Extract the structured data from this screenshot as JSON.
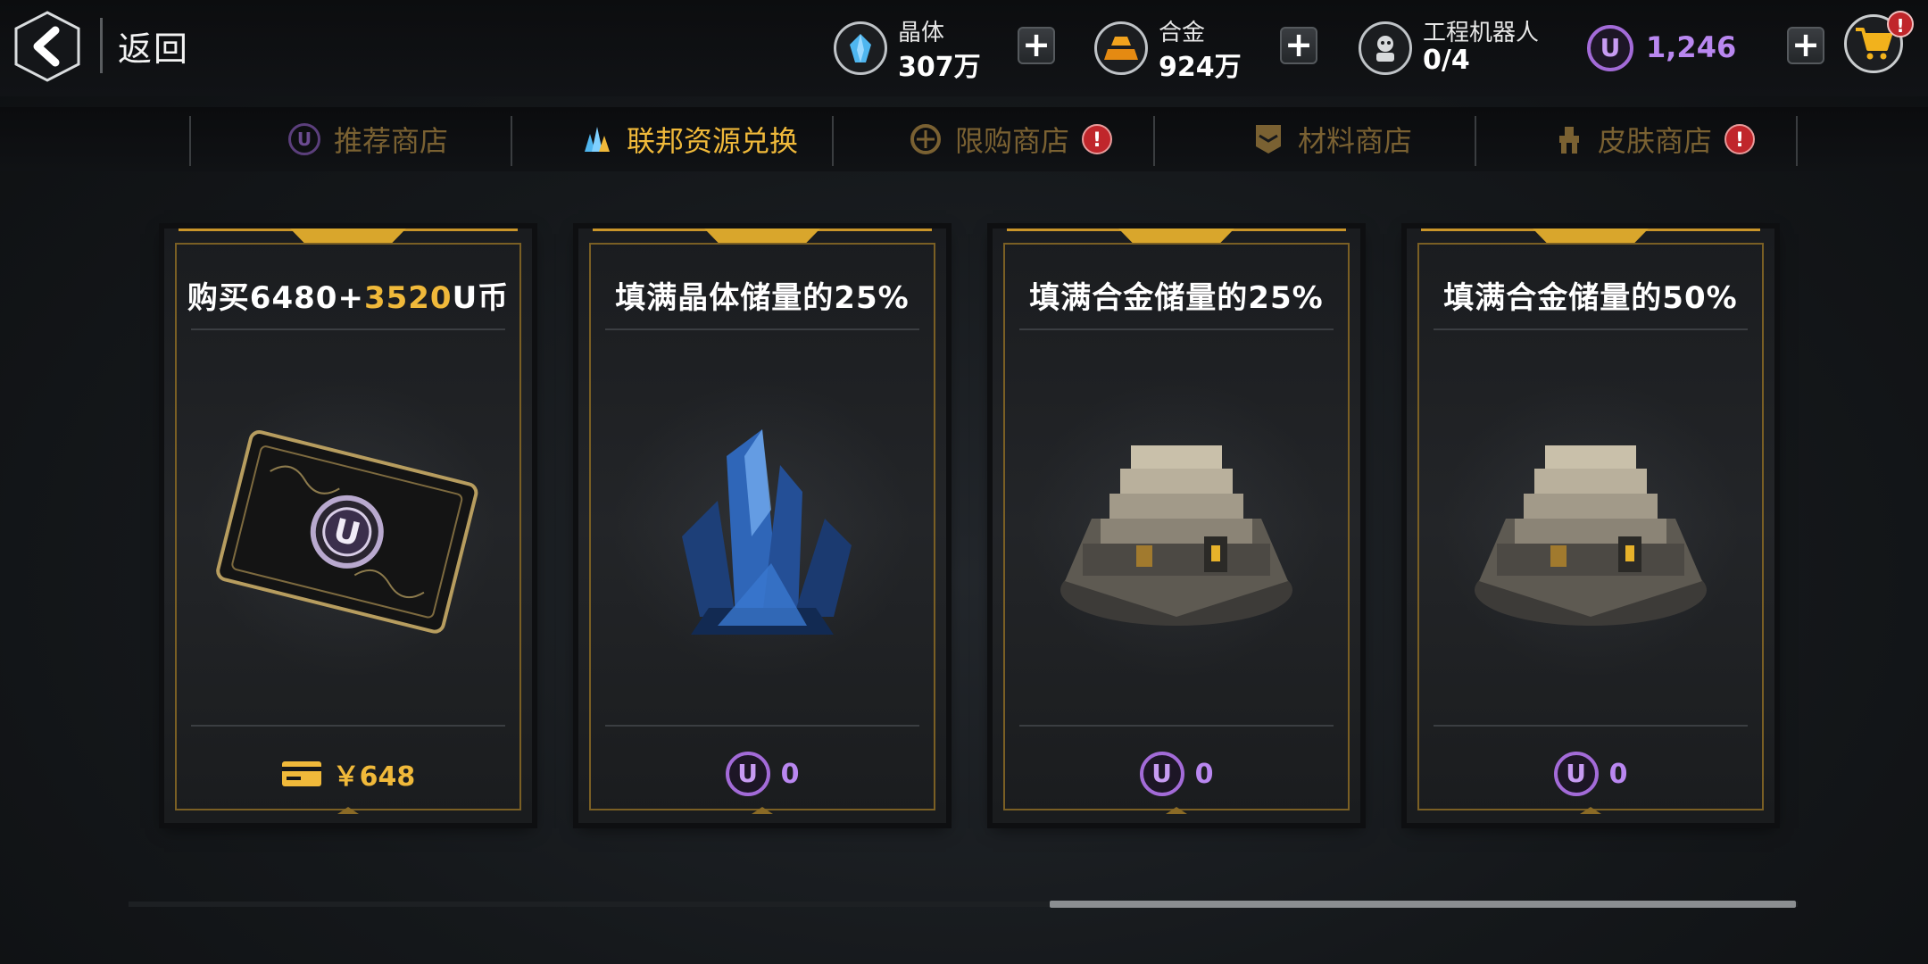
{
  "header": {
    "back_label": "返回"
  },
  "resources": [
    {
      "id": "crystal",
      "name": "晶体",
      "value": "307万",
      "icon": "crystal-icon"
    },
    {
      "id": "alloy",
      "name": "合金",
      "value": "924万",
      "icon": "alloy-icon"
    },
    {
      "id": "robot",
      "name": "工程机器人",
      "value": "0/4",
      "icon": "robot-icon"
    }
  ],
  "ucoin": {
    "value": "1,246",
    "icon_letter": "U"
  },
  "cart_badge": "!",
  "tabs": [
    {
      "label": "推荐商店",
      "icon": "u-coin-icon",
      "active": false,
      "badge": ""
    },
    {
      "label": "联邦资源兑换",
      "icon": "crystal-icon",
      "active": true,
      "badge": ""
    },
    {
      "label": "限购商店",
      "icon": "limited-icon",
      "active": false,
      "badge": "!"
    },
    {
      "label": "材料商店",
      "icon": "material-icon",
      "active": false,
      "badge": ""
    },
    {
      "label": "皮肤商店",
      "icon": "skin-icon",
      "active": false,
      "badge": "!"
    }
  ],
  "cards": [
    {
      "title_pre": "购买6480+",
      "title_hl": "3520",
      "title_post": "U币",
      "price_type": "rmb",
      "price": "￥648",
      "art": "ucard"
    },
    {
      "title_pre": "填满晶体储量的25%",
      "title_hl": "",
      "title_post": "",
      "price_type": "ucoin",
      "price": "0",
      "art": "crystal"
    },
    {
      "title_pre": "填满合金储量的25%",
      "title_hl": "",
      "title_post": "",
      "price_type": "ucoin",
      "price": "0",
      "art": "alloy"
    },
    {
      "title_pre": "填满合金储量的50%",
      "title_hl": "",
      "title_post": "",
      "price_type": "ucoin",
      "price": "0",
      "art": "alloy"
    }
  ],
  "colors": {
    "accent_gold": "#f0b93a",
    "ucoin_purple": "#b987f0",
    "badge_red": "#c0262b"
  }
}
